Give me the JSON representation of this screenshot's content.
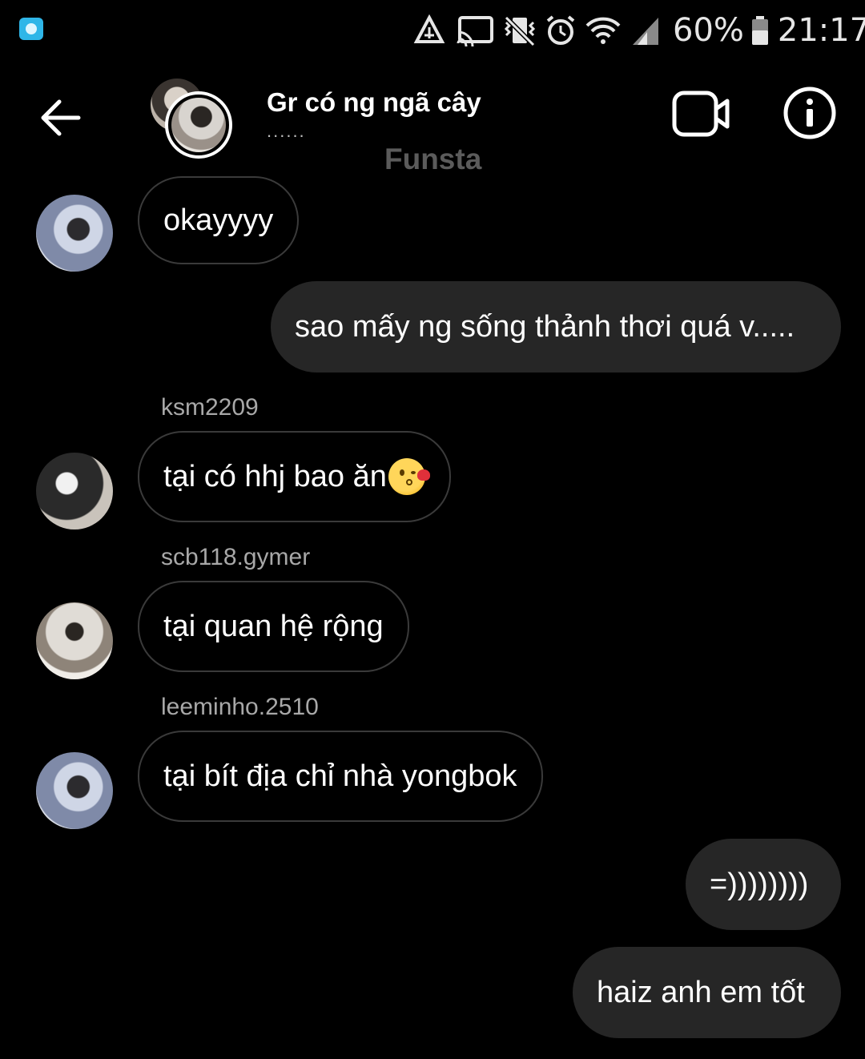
{
  "status_bar": {
    "battery_percent": "60%",
    "time": "21:17",
    "icons": [
      "recycle-icon",
      "cast-icon",
      "vibrate-mute-icon",
      "alarm-icon",
      "wifi-icon",
      "signal-icon",
      "battery-icon"
    ]
  },
  "header": {
    "title": "Gr có ng ngã cây",
    "subtitle": "......",
    "watermark": "Funsta",
    "icons": [
      "back-arrow-icon",
      "video-call-icon",
      "info-icon"
    ]
  },
  "messages": [
    {
      "direction": "in",
      "sender": "",
      "text": "okayyyy"
    },
    {
      "direction": "out",
      "text": "sao mấy ng sống thảnh thơi quá v....."
    },
    {
      "direction": "in",
      "sender": "ksm2209",
      "text": "tại có hhj bao ăn",
      "emoji": "kissing-face-with-heart-emoji"
    },
    {
      "direction": "in",
      "sender": "scb118.gymer",
      "text": "tại quan hệ rộng"
    },
    {
      "direction": "in",
      "sender": "leeminho.2510",
      "text": "tại bít địa chỉ nhà yongbok"
    },
    {
      "direction": "out",
      "text": "=))))))))"
    },
    {
      "direction": "out",
      "text": "haiz anh em tốt"
    }
  ]
}
